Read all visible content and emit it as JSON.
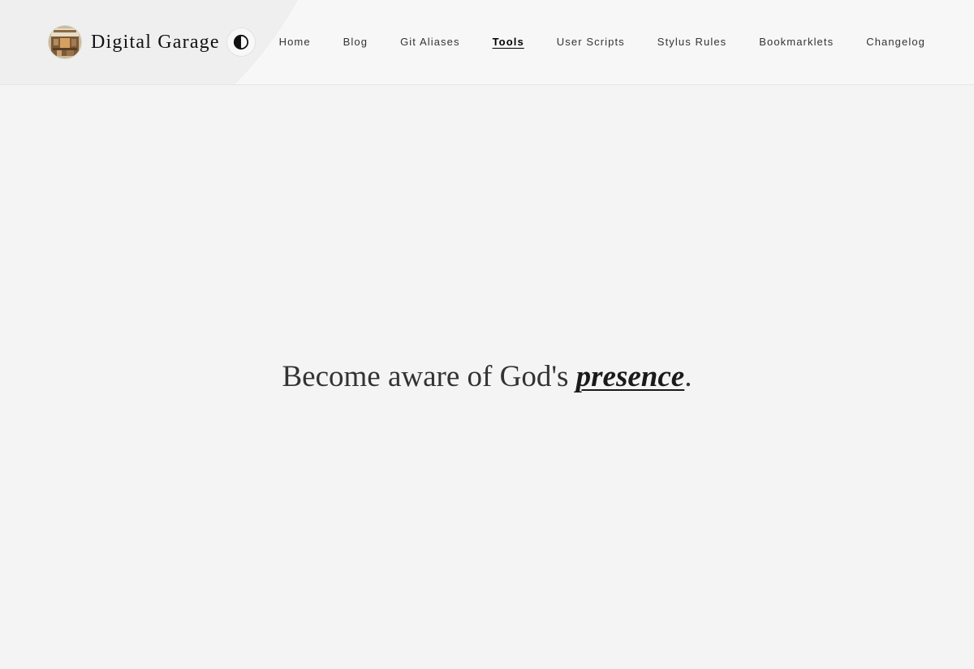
{
  "brand": {
    "title": "Digital Garage",
    "avatar_icon": "workbench-avatar-icon",
    "theme_toggle_icon": "half-circle-contrast-icon"
  },
  "nav": {
    "items": [
      {
        "label": "Home",
        "active": false
      },
      {
        "label": "Blog",
        "active": false
      },
      {
        "label": "Git Aliases",
        "active": false
      },
      {
        "label": "Tools",
        "active": true
      },
      {
        "label": "User Scripts",
        "active": false
      },
      {
        "label": "Stylus Rules",
        "active": false
      },
      {
        "label": "Bookmarklets",
        "active": false
      },
      {
        "label": "Changelog",
        "active": false
      }
    ]
  },
  "main": {
    "quote_before": "Become aware of God's ",
    "quote_emphasis": "presence",
    "quote_after": "."
  },
  "colors": {
    "background": "#f4f4f4",
    "header_background": "#f7f7f7",
    "text": "#333333",
    "active_link": "#000000"
  }
}
